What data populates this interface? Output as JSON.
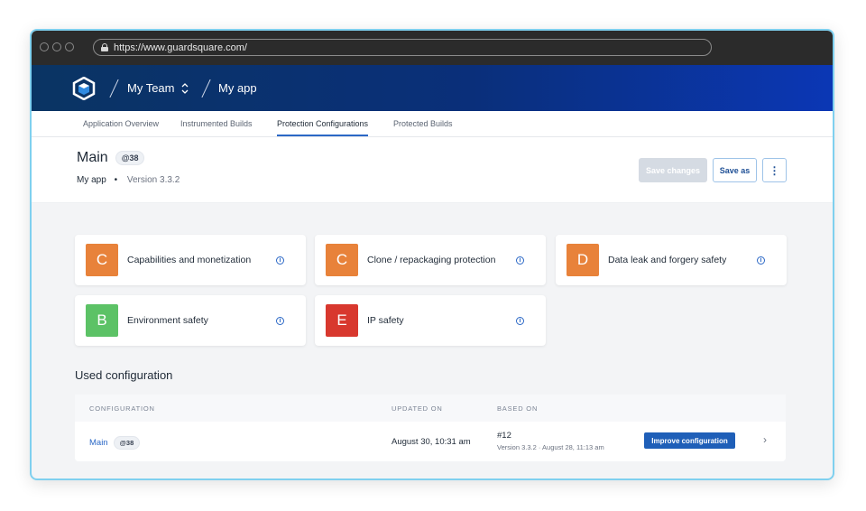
{
  "browser": {
    "url": "https://www.guardsquare.com/"
  },
  "header": {
    "team": "My Team",
    "app": "My app"
  },
  "tabs": [
    {
      "label": "Application Overview"
    },
    {
      "label": "Instrumented Builds"
    },
    {
      "label": "Protection Configurations"
    },
    {
      "label": "Protected Builds"
    }
  ],
  "config": {
    "title": "Main",
    "badge": "@38",
    "app_name": "My app",
    "bullet": "•",
    "version": "Version 3.3.2",
    "save_changes": "Save changes",
    "save_as": "Save as",
    "more": "⋮"
  },
  "cards": [
    {
      "grade": "C",
      "label": "Capabilities and monetization",
      "color": "#e8823a"
    },
    {
      "grade": "C",
      "label": "Clone / repackaging protection",
      "color": "#e8823a"
    },
    {
      "grade": "D",
      "label": "Data leak and forgery safety",
      "color": "#e8823a"
    },
    {
      "grade": "B",
      "label": "Environment safety",
      "color": "#5cc266"
    },
    {
      "grade": "E",
      "label": "IP safety",
      "color": "#d8382e"
    }
  ],
  "info_glyph": "i",
  "used": {
    "title": "Used configuration",
    "headers": {
      "configuration": "CONFIGURATION",
      "updated": "UPDATED ON",
      "based": "BASED ON"
    },
    "row": {
      "name": "Main",
      "badge": "@38",
      "updated": "August 30, 10:31 am",
      "based_id": "#12",
      "based_detail": "Version 3.3.2 · August 28, 11:13 am",
      "action": "Improve configuration",
      "chevron": "›"
    }
  }
}
